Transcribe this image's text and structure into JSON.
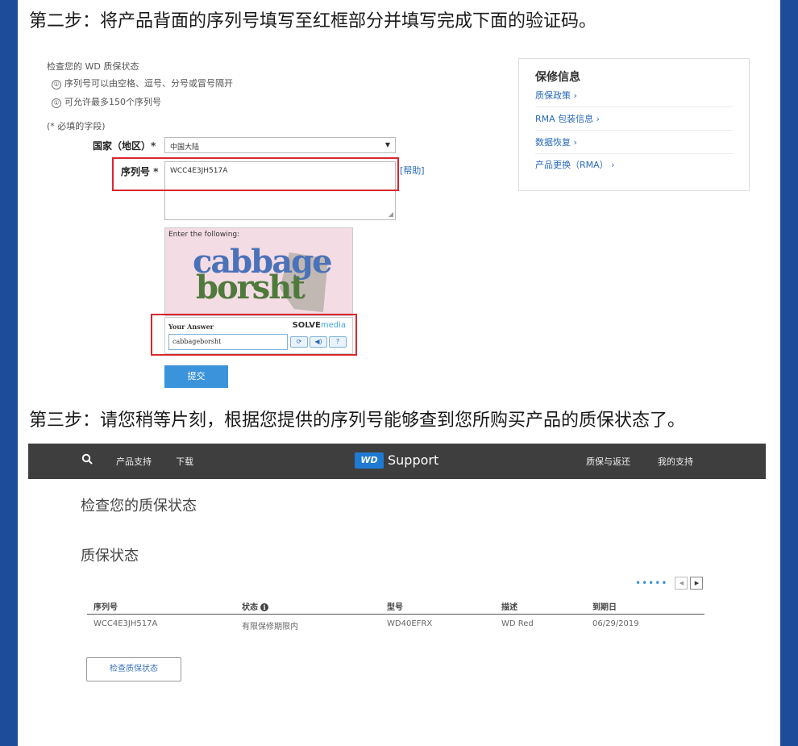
{
  "step2": {
    "heading": "第二步：将产品背面的序列号填写至红框部分并填写完成下面的验证码。"
  },
  "form": {
    "check_title": "检查您的 WD 质保状态",
    "hint_1": "序列号可以由空格、逗号、分号或冒号隔开",
    "hint_2": "可允许最多150个序列号",
    "hint_num_1": "①",
    "hint_num_2": "①",
    "required_note": "(* 必填的字段)",
    "country_label": "国家（地区）*",
    "country_value": "中国大陆",
    "serial_label": "序列号 *",
    "serial_value": "WCC4E3JH517A",
    "help_link": "[帮助]",
    "captcha_prompt": "Enter the following:",
    "captcha_word_1": "cabbage",
    "captcha_word_2": "borsht",
    "answer_label": "Your Answer",
    "solve_brand": "SOLVE",
    "solve_media": "media",
    "answer_value": "cabbageborsht",
    "submit_label": "提交"
  },
  "warranty_info": {
    "title": "保修信息",
    "links": [
      "质保政策 ›",
      "RMA 包装信息 ›",
      "数据恢复 ›",
      "产品更换（RMA） ›"
    ]
  },
  "step3": {
    "heading": "第三步：请您稍等片刻，根据您提供的序列号能够查到您所购买产品的质保状态了。"
  },
  "wd_page": {
    "nav_left": [
      "产品支持",
      "下载"
    ],
    "logo_text": "WD",
    "logo_label": "Support",
    "nav_right": [
      "质保与返还",
      "我的支持"
    ],
    "page_title": "检查您的质保状态",
    "section_title": "质保状态",
    "pager_dots": "•••••",
    "table": {
      "headers": [
        "序列号",
        "状态",
        "型号",
        "描述",
        "到期日"
      ],
      "rows": [
        [
          "WCC4E3JH517A",
          "有限保修期限内",
          "WD40EFRX",
          "WD Red",
          "06/29/2019"
        ]
      ]
    },
    "check_button": "检查质保状态"
  },
  "colors": {
    "frame_blue": "#1d4d9a",
    "highlight_red": "#d9272e",
    "link_blue": "#2a6bb8",
    "button_blue": "#3b93dc",
    "nav_dark": "#3e3e3e"
  }
}
